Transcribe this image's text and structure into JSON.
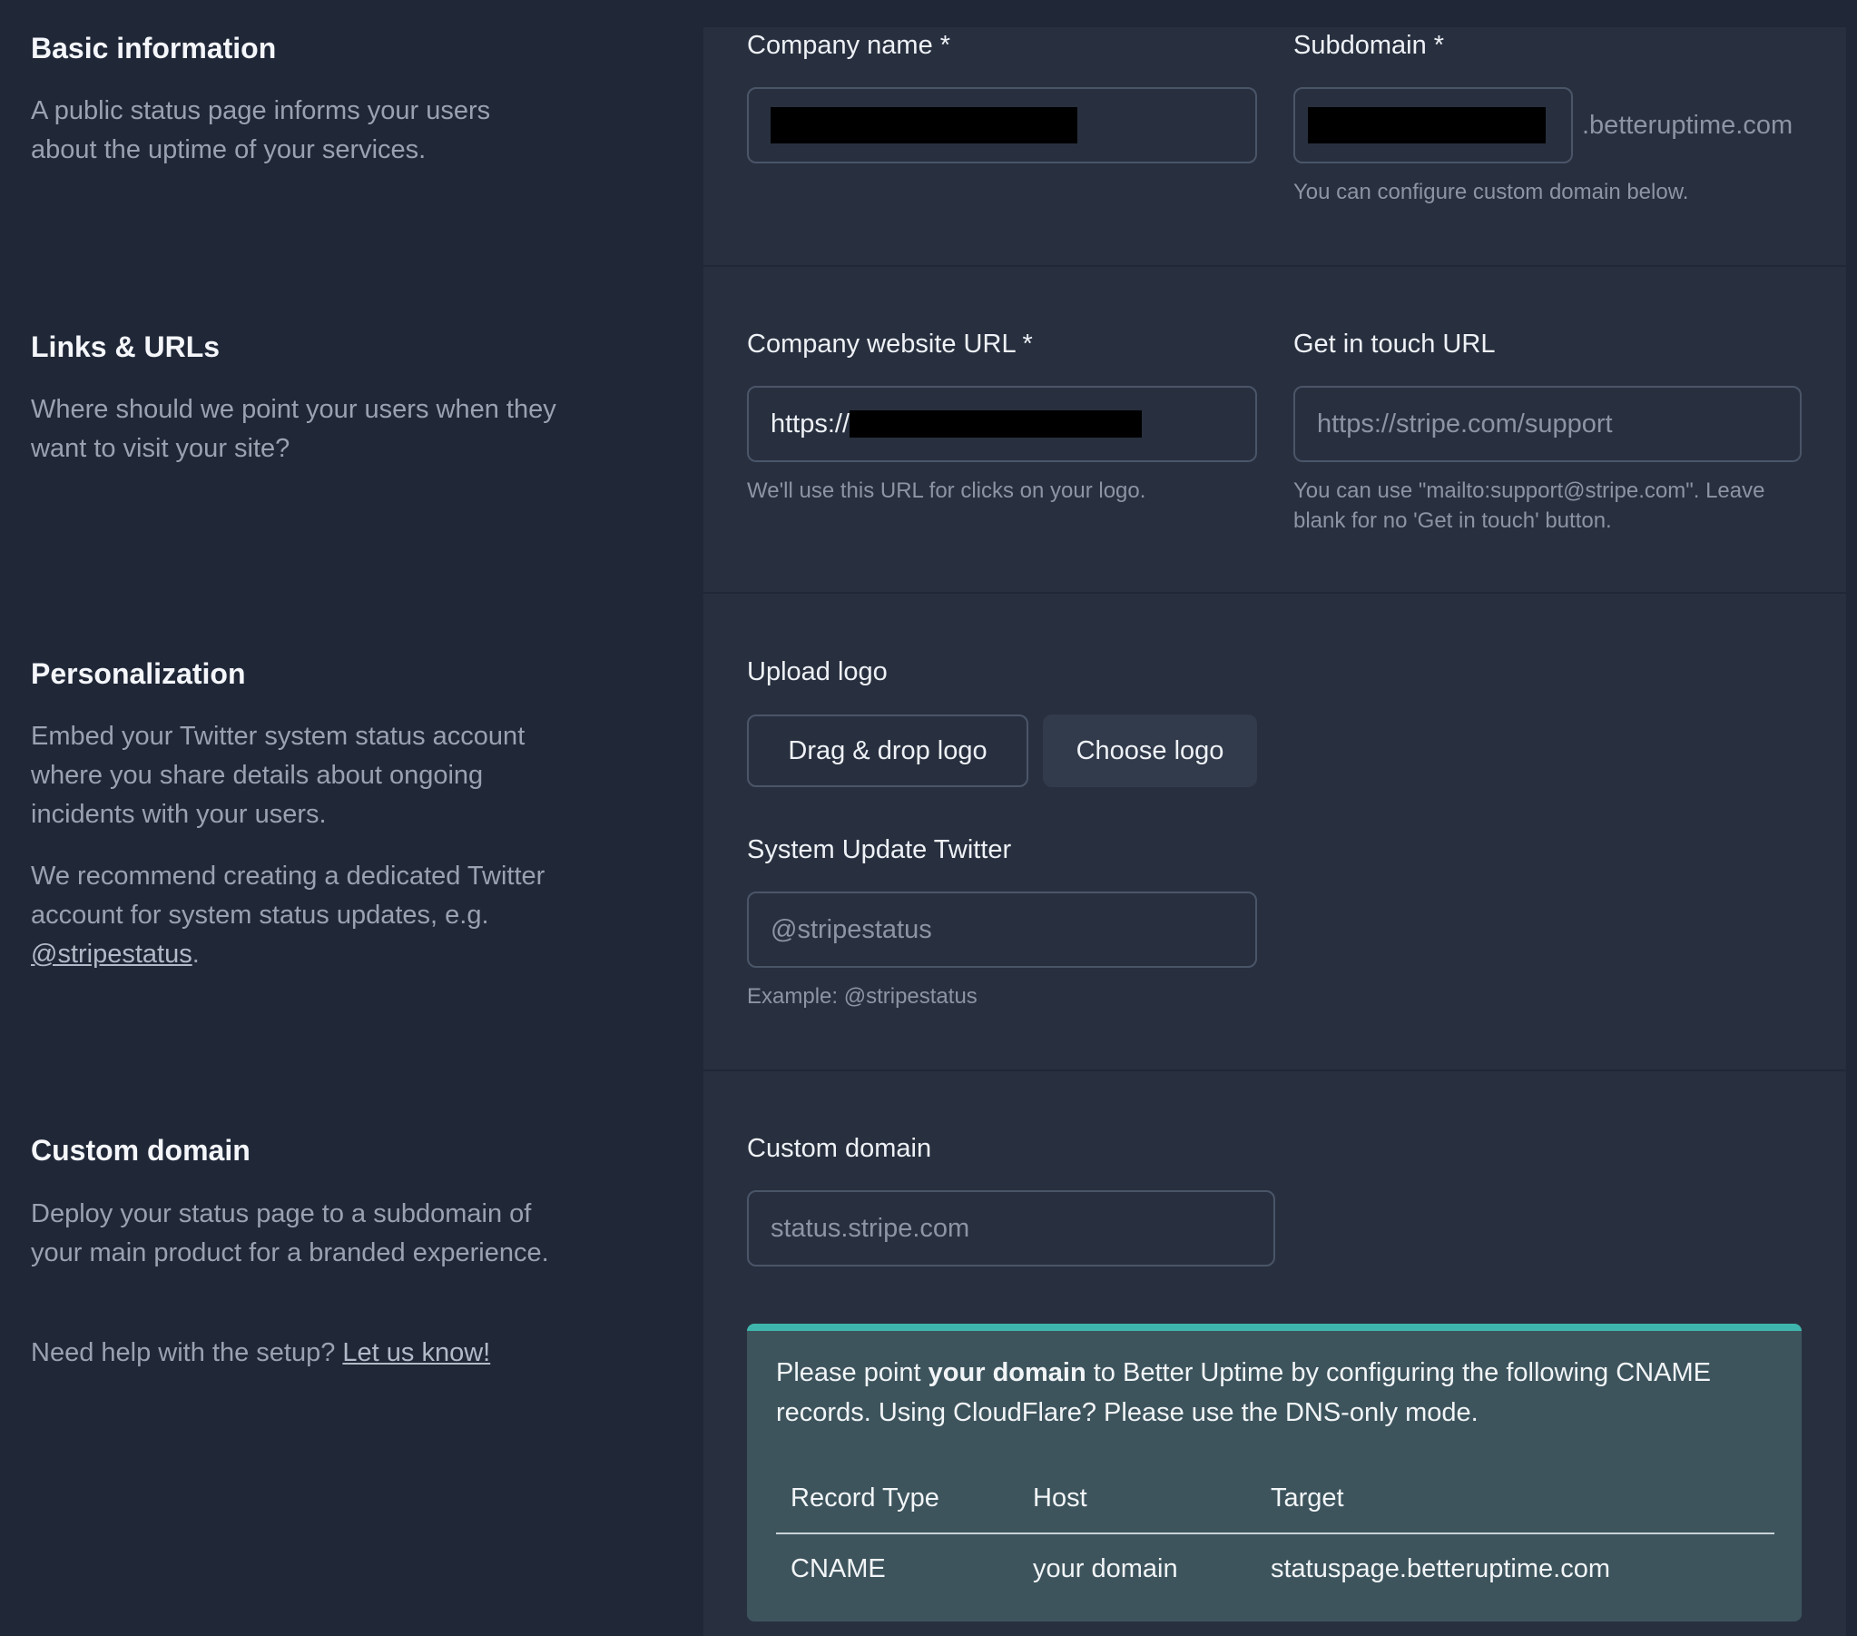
{
  "sections": {
    "basic": {
      "title": "Basic information",
      "description": "A public status page informs your users about the uptime of your services."
    },
    "links": {
      "title": "Links & URLs",
      "description": "Where should we point your users when they want to visit your site?"
    },
    "personalization": {
      "title": "Personalization",
      "description1": "Embed your Twitter system status account where you share details about ongoing incidents with your users.",
      "description2_prefix": "We recommend creating a dedicated Twitter account for system status updates, e.g. ",
      "description2_link": "@stripestatus",
      "description2_suffix": "."
    },
    "custom_domain": {
      "title": "Custom domain",
      "description": "Deploy your status page to a subdomain of your main product for a branded experience.",
      "help_prefix": "Need help with the setup? ",
      "help_link": "Let us know!"
    }
  },
  "fields": {
    "company_name": {
      "label": "Company name *",
      "value_redacted": true
    },
    "subdomain": {
      "label": "Subdomain *",
      "value_redacted": true,
      "suffix": ".betteruptime.com",
      "help": "You can configure custom domain below."
    },
    "company_website_url": {
      "label": "Company website URL *",
      "value_prefix": "https://",
      "value_redacted": true,
      "help": "We'll use this URL for clicks on your logo."
    },
    "get_in_touch_url": {
      "label": "Get in touch URL",
      "placeholder": "https://stripe.com/support",
      "help": "You can use \"mailto:support@stripe.com\". Leave blank for no 'Get in touch' button."
    },
    "upload_logo": {
      "label": "Upload logo",
      "dropzone_label": "Drag & drop logo",
      "choose_button": "Choose logo"
    },
    "system_update_twitter": {
      "label": "System Update Twitter",
      "placeholder": "@stripestatus",
      "help": "Example: @stripestatus"
    },
    "custom_domain": {
      "label": "Custom domain",
      "placeholder": "status.stripe.com"
    }
  },
  "dns_info": {
    "text_before": "Please point ",
    "text_bold": "your domain",
    "text_after": " to Better Uptime by configuring the following CNAME records. Using CloudFlare? Please use the DNS-only mode.",
    "table": {
      "headers": [
        "Record Type",
        "Host",
        "Target"
      ],
      "rows": [
        [
          "CNAME",
          "your domain",
          "statuspage.betteruptime.com"
        ]
      ]
    },
    "accent_color": "#3fb6ad"
  },
  "colors": {
    "page_bg": "#202838",
    "panel_bg": "#28303f",
    "info_box_bg": "#3d545d"
  }
}
